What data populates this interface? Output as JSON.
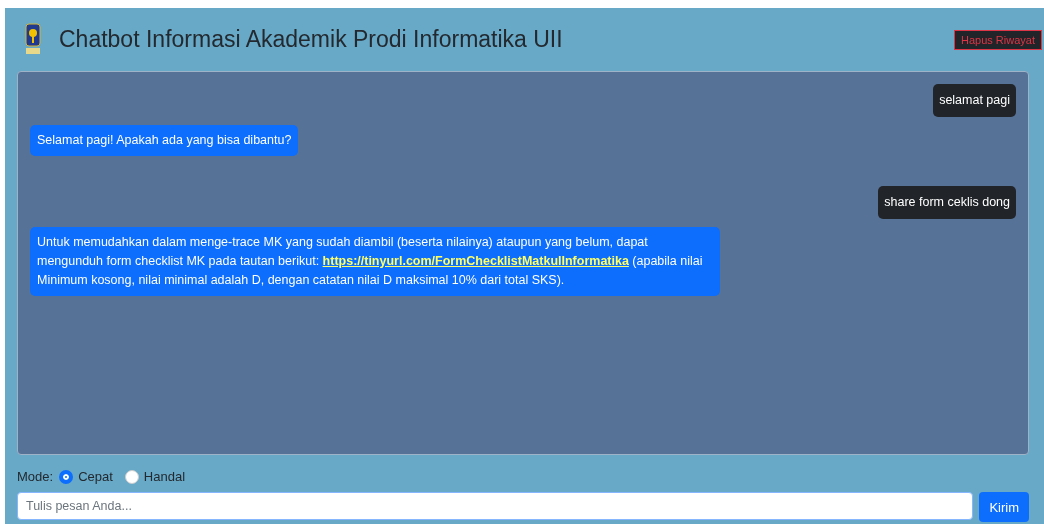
{
  "header": {
    "title": "Chatbot Informasi Akademik Prodi Informatika UII",
    "clear_button": "Hapus Riwayat"
  },
  "messages": [
    {
      "kind": "user",
      "text": "selamat pagi"
    },
    {
      "kind": "bot",
      "text": "Selamat pagi! Apakah ada yang bisa dibantu?"
    },
    {
      "kind": "user",
      "text": "share form ceklis dong"
    },
    {
      "kind": "bot",
      "text": "Untuk memudahkan dalam menge-trace MK yang sudah diambil (beserta nilainya) ataupun yang belum, dapat mengunduh form checklist MK pada tautan berikut: ",
      "link": "https://tinyurl.com/FormChecklistMatkulInformatika",
      "text_after": " (apabila nilai Minimum kosong, nilai minimal adalah D, dengan catatan nilai D maksimal 10% dari total SKS)."
    }
  ],
  "mode": {
    "label": "Mode:",
    "options": [
      {
        "label": "Cepat",
        "selected": true
      },
      {
        "label": "Handal",
        "selected": false
      }
    ]
  },
  "input": {
    "placeholder": "Tulis pesan Anda...",
    "send_button": "Kirim"
  }
}
